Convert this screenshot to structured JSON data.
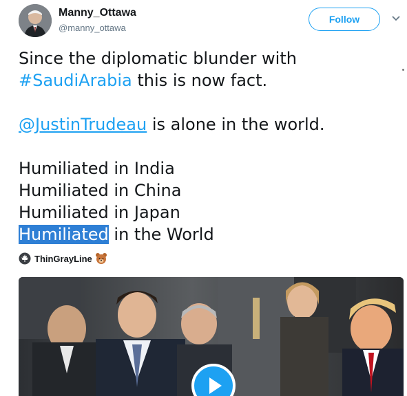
{
  "author": {
    "display_name": "Manny_Ottawa",
    "handle": "@manny_ottawa",
    "avatar_icon": "user-avatar"
  },
  "follow_button": {
    "label": "Follow"
  },
  "tweet": {
    "lines": {
      "l1": "Since the diplomatic blunder with",
      "l2_hashtag": "#SaudiArabia",
      "l2_rest": " this is now fact.",
      "l3_mention": "@JustinTrudeau",
      "l3_rest": " is alone in the world.",
      "l4": "Humiliated in India",
      "l5": "Humiliated in China",
      "l6": "Humiliated in Japan",
      "l7_selected": "Humiliated",
      "l7_rest": " in the World"
    }
  },
  "app_attribution": {
    "name": "ThinGrayLine",
    "left_icon": "maple-leaf-icon",
    "right_icon": "bear-emoji-icon"
  },
  "media": {
    "type": "video",
    "play_icon": "play-icon"
  },
  "colors": {
    "accent": "#1da1f2",
    "selection": "#2e7fd5",
    "text": "#14171a",
    "muted": "#657786"
  }
}
